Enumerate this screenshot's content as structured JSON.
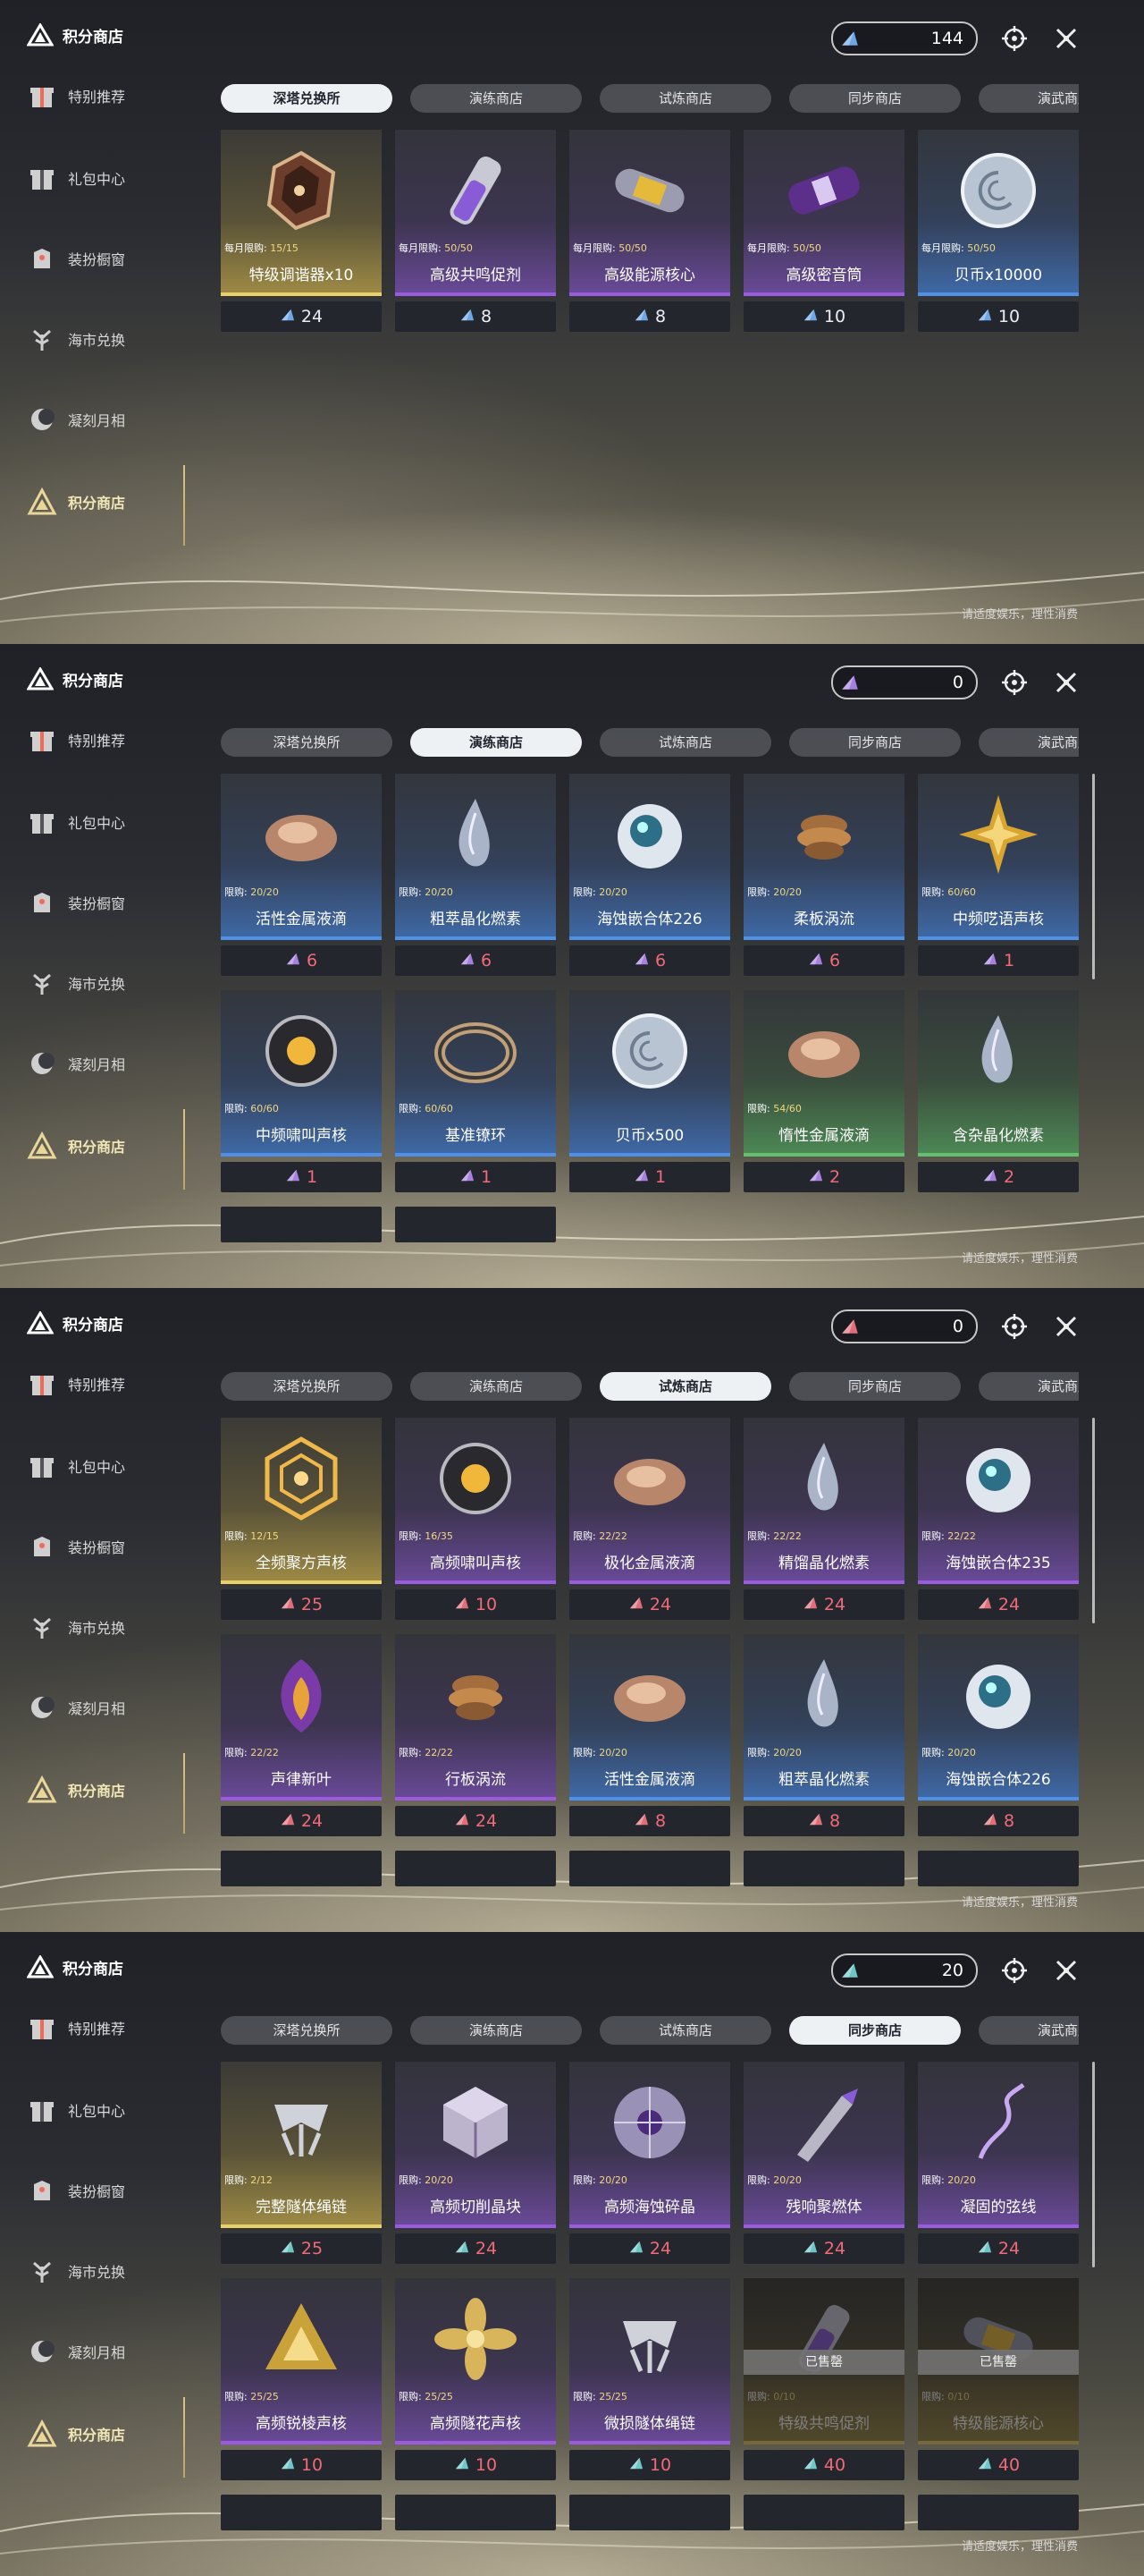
{
  "app": {
    "brand_title": "积分商店",
    "sidebar_items": [
      "特别推荐",
      "礼包中心",
      "装扮橱窗",
      "海市兑换",
      "凝刻月相",
      "积分商店"
    ],
    "tabs": [
      "深塔兑换所",
      "演练商店",
      "试炼商店",
      "同步商店",
      "演武商店"
    ],
    "footer": "请适度娱乐，理性消费"
  },
  "screens": [
    {
      "currency_value": "144",
      "currency_color": "#6ea6e6",
      "active_tab": 0,
      "cards": [
        {
          "limit_label": "每月限购:",
          "limit": "15/15",
          "name": "特级调谐器x10",
          "price": "24",
          "theme": "gold",
          "icon": "tuner-icon"
        },
        {
          "limit_label": "每月限购:",
          "limit": "50/50",
          "name": "高级共鸣促剂",
          "price": "8",
          "theme": "purple",
          "icon": "vial-icon"
        },
        {
          "limit_label": "每月限购:",
          "limit": "50/50",
          "name": "高级能源核心",
          "price": "8",
          "theme": "purple",
          "icon": "capsule-icon"
        },
        {
          "limit_label": "每月限购:",
          "limit": "50/50",
          "name": "高级密音筒",
          "price": "10",
          "theme": "purple",
          "icon": "cylinder-icon"
        },
        {
          "limit_label": "每月限购:",
          "limit": "50/50",
          "name": "贝币x10000",
          "price": "10",
          "theme": "blue",
          "icon": "shell-coin-icon"
        }
      ],
      "stubs": 0
    },
    {
      "currency_value": "0",
      "currency_color": "#a780e0",
      "active_tab": 1,
      "cards": [
        {
          "limit_label": "限购:",
          "limit": "20/20",
          "name": "活性金属液滴",
          "price": "6",
          "theme": "blue",
          "icon": "metal-drop-icon"
        },
        {
          "limit_label": "限购:",
          "limit": "20/20",
          "name": "粗萃晶化燃素",
          "price": "6",
          "theme": "blue",
          "icon": "crystal-drop-icon"
        },
        {
          "limit_label": "限购:",
          "limit": "20/20",
          "name": "海蚀嵌合体226",
          "price": "6",
          "theme": "blue",
          "icon": "orb-icon"
        },
        {
          "limit_label": "限购:",
          "limit": "20/20",
          "name": "柔板涡流",
          "price": "6",
          "theme": "blue",
          "icon": "spiral-icon"
        },
        {
          "limit_label": "限购:",
          "limit": "60/60",
          "name": "中频呓语声核",
          "price": "1",
          "theme": "blue",
          "icon": "star-core-icon"
        },
        {
          "limit_label": "限购:",
          "limit": "60/60",
          "name": "中频啸叫声核",
          "price": "1",
          "theme": "blue",
          "icon": "gear-core-icon"
        },
        {
          "limit_label": "限购:",
          "limit": "60/60",
          "name": "基准镣环",
          "price": "1",
          "theme": "blue",
          "icon": "ring-icon"
        },
        {
          "limit_label": "",
          "limit": "",
          "name": "贝币x500",
          "price": "1",
          "theme": "blue",
          "icon": "shell-coin-icon"
        },
        {
          "limit_label": "限购:",
          "limit": "54/60",
          "name": "惰性金属液滴",
          "price": "2",
          "theme": "green",
          "icon": "metal-drop-icon"
        },
        {
          "limit_label": "",
          "limit": "",
          "name": "含杂晶化燃素",
          "price": "2",
          "theme": "green",
          "icon": "crystal-drop-icon"
        }
      ],
      "stubs": 2
    },
    {
      "currency_value": "0",
      "currency_color": "#e06e7a",
      "active_tab": 2,
      "cards": [
        {
          "limit_label": "限购:",
          "limit": "12/15",
          "name": "全频聚方声核",
          "price": "25",
          "theme": "gold",
          "icon": "hex-core-icon"
        },
        {
          "limit_label": "限购:",
          "limit": "16/35",
          "name": "高频啸叫声核",
          "price": "10",
          "theme": "purple",
          "icon": "gear-core-icon"
        },
        {
          "limit_label": "限购:",
          "limit": "22/22",
          "name": "极化金属液滴",
          "price": "24",
          "theme": "purple",
          "icon": "metal-drop-icon"
        },
        {
          "limit_label": "限购:",
          "limit": "22/22",
          "name": "精馏晶化燃素",
          "price": "24",
          "theme": "purple",
          "icon": "crystal-drop-icon"
        },
        {
          "limit_label": "限购:",
          "limit": "22/22",
          "name": "海蚀嵌合体235",
          "price": "24",
          "theme": "purple",
          "icon": "orb-icon"
        },
        {
          "limit_label": "限购:",
          "limit": "22/22",
          "name": "声律新叶",
          "price": "24",
          "theme": "purple",
          "icon": "leaf-icon"
        },
        {
          "limit_label": "限购:",
          "limit": "22/22",
          "name": "行板涡流",
          "price": "24",
          "theme": "purple",
          "icon": "spiral-icon"
        },
        {
          "limit_label": "限购:",
          "limit": "20/20",
          "name": "活性金属液滴",
          "price": "8",
          "theme": "blue",
          "icon": "metal-drop-icon"
        },
        {
          "limit_label": "限购:",
          "limit": "20/20",
          "name": "粗萃晶化燃素",
          "price": "8",
          "theme": "blue",
          "icon": "crystal-drop-icon"
        },
        {
          "limit_label": "限购:",
          "limit": "20/20",
          "name": "海蚀嵌合体226",
          "price": "8",
          "theme": "blue",
          "icon": "orb-icon"
        }
      ],
      "stubs": 5
    },
    {
      "currency_value": "20",
      "currency_color": "#6ec6c6",
      "active_tab": 3,
      "cards": [
        {
          "limit_label": "限购:",
          "limit": "2/12",
          "name": "完整隧体绳链",
          "price": "25",
          "theme": "gold",
          "icon": "chain-icon"
        },
        {
          "limit_label": "限购:",
          "limit": "20/20",
          "name": "高频切削晶块",
          "price": "24",
          "theme": "purple",
          "icon": "cube-icon"
        },
        {
          "limit_label": "限购:",
          "limit": "20/20",
          "name": "高频海蚀碎晶",
          "price": "24",
          "theme": "purple",
          "icon": "disc-icon"
        },
        {
          "limit_label": "限购:",
          "limit": "20/20",
          "name": "残响聚燃体",
          "price": "24",
          "theme": "purple",
          "icon": "blade-icon"
        },
        {
          "limit_label": "限购:",
          "limit": "20/20",
          "name": "凝固的弦线",
          "price": "24",
          "theme": "purple",
          "icon": "string-icon"
        },
        {
          "limit_label": "限购:",
          "limit": "25/25",
          "name": "高频锐棱声核",
          "price": "10",
          "theme": "purple",
          "icon": "tri-core-icon"
        },
        {
          "limit_label": "限购:",
          "limit": "25/25",
          "name": "高频隧花声核",
          "price": "10",
          "theme": "purple",
          "icon": "flower-core-icon"
        },
        {
          "limit_label": "限购:",
          "limit": "25/25",
          "name": "微损隧体绳链",
          "price": "10",
          "theme": "purple",
          "icon": "chain-icon"
        },
        {
          "limit_label": "限购:",
          "limit": "0/10",
          "name": "特级共鸣促剂",
          "price": "40",
          "theme": "gold",
          "icon": "vial-icon",
          "sold_out": "已售罄"
        },
        {
          "limit_label": "限购:",
          "limit": "0/10",
          "name": "特级能源核心",
          "price": "40",
          "theme": "gold",
          "icon": "capsule-icon",
          "sold_out": "已售罄"
        }
      ],
      "stubs": 5
    }
  ]
}
